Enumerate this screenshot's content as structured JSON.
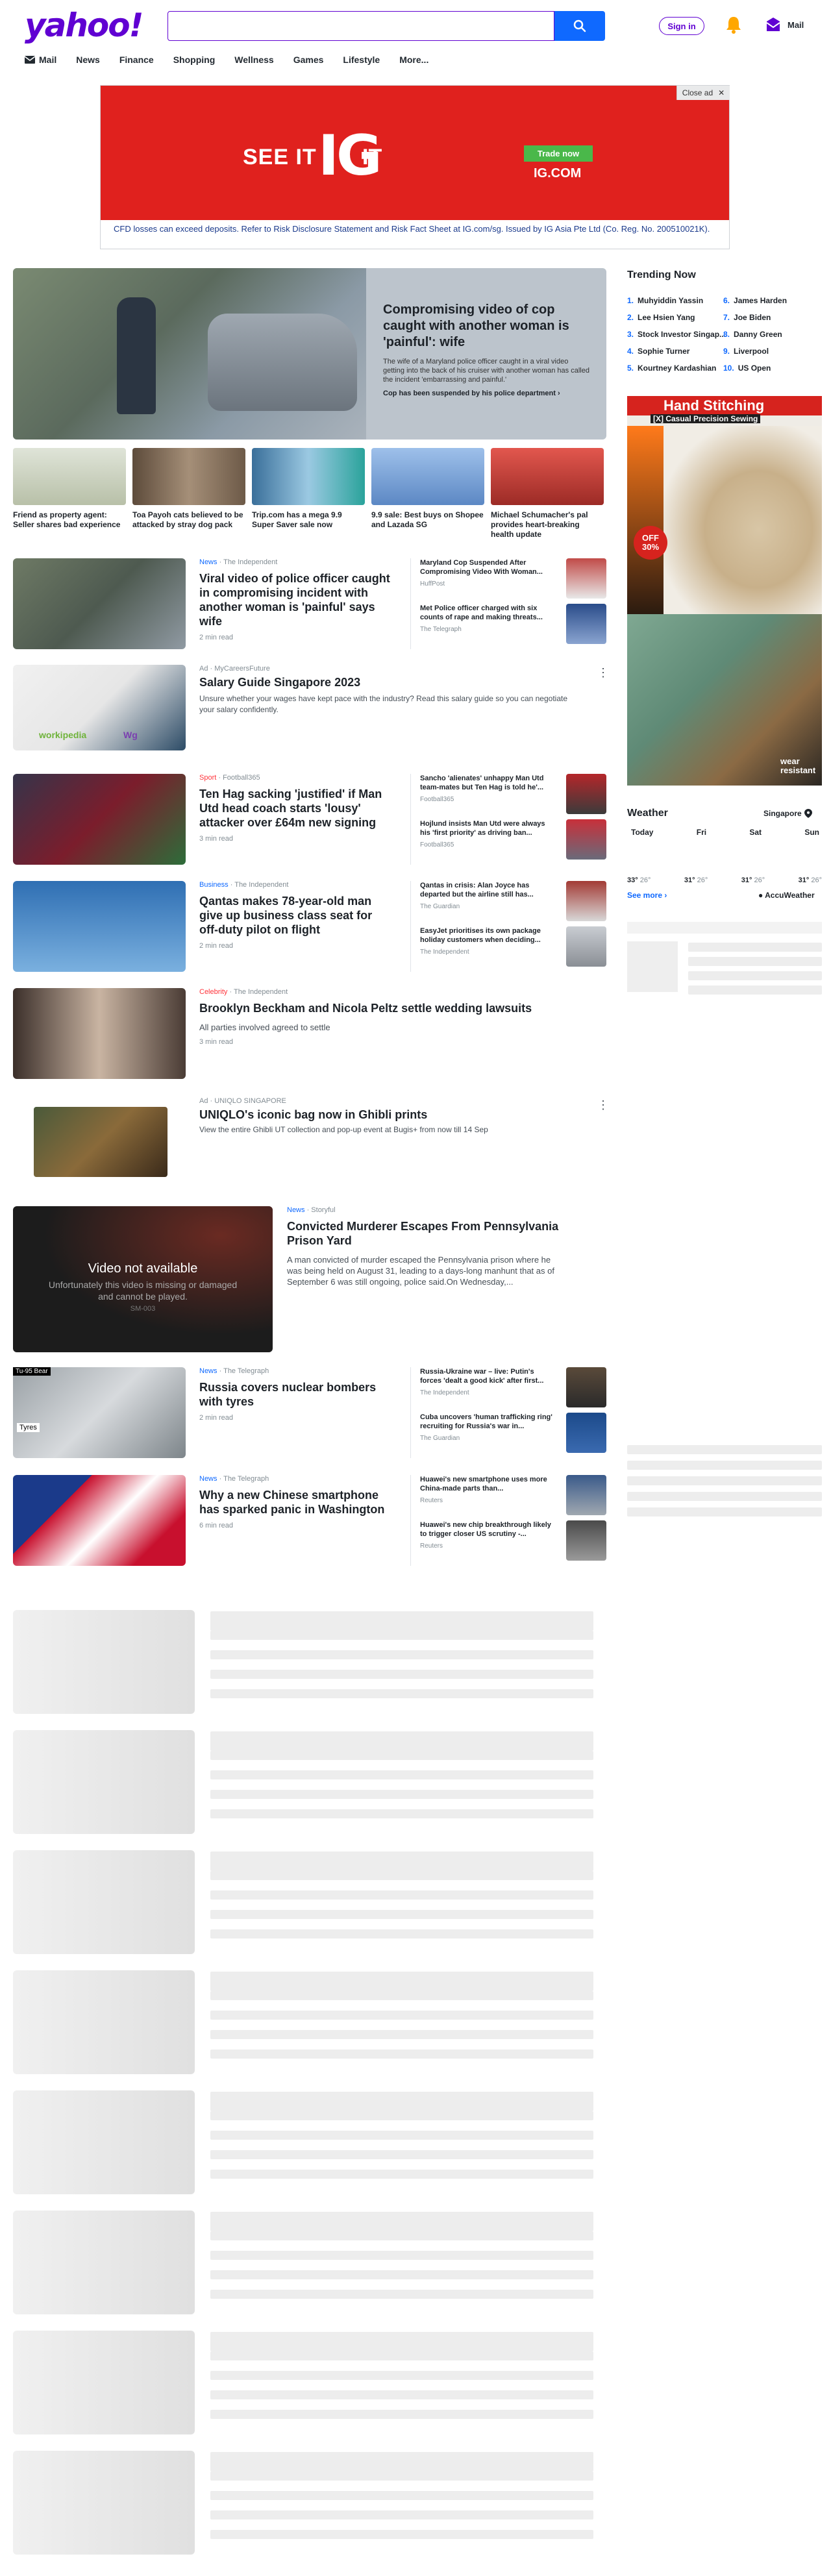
{
  "header": {
    "logo": "yahoo!",
    "search": {
      "value": "",
      "placeholder": ""
    },
    "signin": "Sign in",
    "mail": "Mail",
    "nav": [
      "Mail",
      "News",
      "Finance",
      "Shopping",
      "Wellness",
      "Games",
      "Lifestyle",
      "More..."
    ]
  },
  "ad": {
    "close": "Close ad",
    "see_it": "SEE IT",
    "ig": "IG",
    "it": "IT",
    "trade_now": "Trade now",
    "ig_com": "IG.COM",
    "disclaimer": "CFD losses can exceed deposits. Refer to Risk Disclosure Statement and Risk Fact Sheet at IG.com/sg. Issued by IG Asia Pte Ltd (Co. Reg. No. 200510021K)."
  },
  "hero": {
    "title": "Compromising video of cop caught with another woman is 'painful': wife",
    "desc": "The wife of a Maryland police officer caught in a viral video getting into the back of his cruiser with another woman has called the incident 'embarrassing and painful.'",
    "link": "Cop has been suspended by his police department ›"
  },
  "thumbs": [
    {
      "text": "Friend as property agent: Seller shares bad experience",
      "color": "#c9d3c0"
    },
    {
      "text": "Toa Payoh cats believed to be attacked by stray dog pack",
      "color": "#8a7664"
    },
    {
      "text": "Trip.com has a mega 9.9 Super Saver sale now",
      "color": "#6fa7c9"
    },
    {
      "text": "9.9 sale: Best buys on Shopee and Lazada SG",
      "color": "#7fa3cf"
    },
    {
      "text": "Michael Schumacher's pal provides heart-breaking health update",
      "color": "#c8423b"
    }
  ],
  "trending": {
    "title": "Trending Now",
    "left": [
      {
        "n": "1.",
        "t": "Muhyiddin Yassin"
      },
      {
        "n": "2.",
        "t": "Lee Hsien Yang"
      },
      {
        "n": "3.",
        "t": "Stock Investor Singap..."
      },
      {
        "n": "4.",
        "t": "Sophie Turner"
      },
      {
        "n": "5.",
        "t": "Kourtney Kardashian"
      }
    ],
    "right": [
      {
        "n": "6.",
        "t": "James Harden"
      },
      {
        "n": "7.",
        "t": "Joe Biden"
      },
      {
        "n": "8.",
        "t": "Danny Green"
      },
      {
        "n": "9.",
        "t": "Liverpool"
      },
      {
        "n": "10.",
        "t": "US Open"
      }
    ]
  },
  "side_ad": {
    "title": "Hand Stitching",
    "sub": "[X] Casual Precision Sewing",
    "off": "OFF 30%",
    "wear": "wear resistant"
  },
  "weather": {
    "title": "Weather",
    "location": "Singapore",
    "days": [
      "Today",
      "Fri",
      "Sat",
      "Sun"
    ],
    "temps": [
      {
        "hi": "33°",
        "lo": "26°"
      },
      {
        "hi": "31°",
        "lo": "26°"
      },
      {
        "hi": "31°",
        "lo": "26°"
      },
      {
        "hi": "31°",
        "lo": "26°"
      }
    ],
    "see_more": "See more ›",
    "accu": "AccuWeather"
  },
  "stories": [
    {
      "category": "News",
      "source": "The Independent",
      "title": "Viral video of police officer caught in compromising incident with another woman is 'painful' says wife",
      "read": "2 min read",
      "side": [
        {
          "title": "Maryland Cop Suspended After Compromising Video With Woman...",
          "src": "HuffPost"
        },
        {
          "title": "Met Police officer charged with six counts of rape and making threats...",
          "src": "The Telegraph"
        }
      ]
    },
    {
      "ad": "Ad",
      "source": "MyCareersFuture",
      "title": "Salary Guide Singapore 2023",
      "desc": "Unsure whether your wages have kept pace with the industry? Read this salary guide so you can negotiate your salary confidently.",
      "brand1": "workipedia",
      "brand2": "Wg"
    },
    {
      "category": "Sport",
      "source": "Football365",
      "title": "Ten Hag sacking 'justified' if Man Utd head coach starts 'lousy' attacker over £64m new signing",
      "read": "3 min read",
      "side": [
        {
          "title": "Sancho 'alienates' unhappy Man Utd team-mates but Ten Hag is told he'...",
          "src": "Football365"
        },
        {
          "title": "Hojlund insists Man Utd were always his 'first priority' as driving ban...",
          "src": "Football365"
        }
      ]
    },
    {
      "category": "Business",
      "source": "The Independent",
      "title": "Qantas makes 78-year-old man give up business class seat for off-duty pilot on flight",
      "read": "2 min read",
      "side": [
        {
          "title": "Qantas in crisis: Alan Joyce has departed but the airline still has...",
          "src": "The Guardian"
        },
        {
          "title": "EasyJet prioritises its own package holiday customers when deciding...",
          "src": "The Independent"
        }
      ]
    },
    {
      "category": "Celebrity",
      "source": "The Independent",
      "title": "Brooklyn Beckham and Nicola Peltz settle wedding lawsuits",
      "desc": "All parties involved agreed to settle",
      "read": "3 min read"
    },
    {
      "ad": "Ad",
      "source": "UNIQLO SINGAPORE",
      "title": "UNIQLO's iconic bag now in Ghibli prints",
      "desc": "View the entire Ghibli UT collection and pop-up event at Bugis+ from now till 14 Sep"
    },
    {
      "category": "News",
      "source": "Storyful",
      "title": "Convicted Murderer Escapes From Pennsylvania Prison Yard",
      "desc": "A man convicted of murder escaped the Pennsylvania prison where he was being held on August 31, leading to a days-long manhunt that as of September 6 was still ongoing, police said.On Wednesday,...",
      "video_na": "Video not available",
      "video_msg": "Unfortunately this video is missing or damaged and cannot be played.",
      "video_code": "SM-003"
    },
    {
      "category": "News",
      "source": "The Telegraph",
      "title": "Russia covers nuclear bombers with tyres",
      "read": "2 min read",
      "badge": "Tu-95 Bear",
      "tyres": "Tyres",
      "side": [
        {
          "title": "Russia-Ukraine war – live: Putin's forces 'dealt a good kick' after first...",
          "src": "The Independent"
        },
        {
          "title": "Cuba uncovers 'human trafficking ring' recruiting for Russia's war in...",
          "src": "The Guardian"
        }
      ]
    },
    {
      "category": "News",
      "source": "The Telegraph",
      "title": "Why a new Chinese smartphone has sparked panic in Washington",
      "read": "6 min read",
      "side": [
        {
          "title": "Huawei's new smartphone uses more China-made parts than...",
          "src": "Reuters"
        },
        {
          "title": "Huawei's new chip breakthrough likely to trigger closer US scrutiny -...",
          "src": "Reuters"
        }
      ]
    }
  ]
}
